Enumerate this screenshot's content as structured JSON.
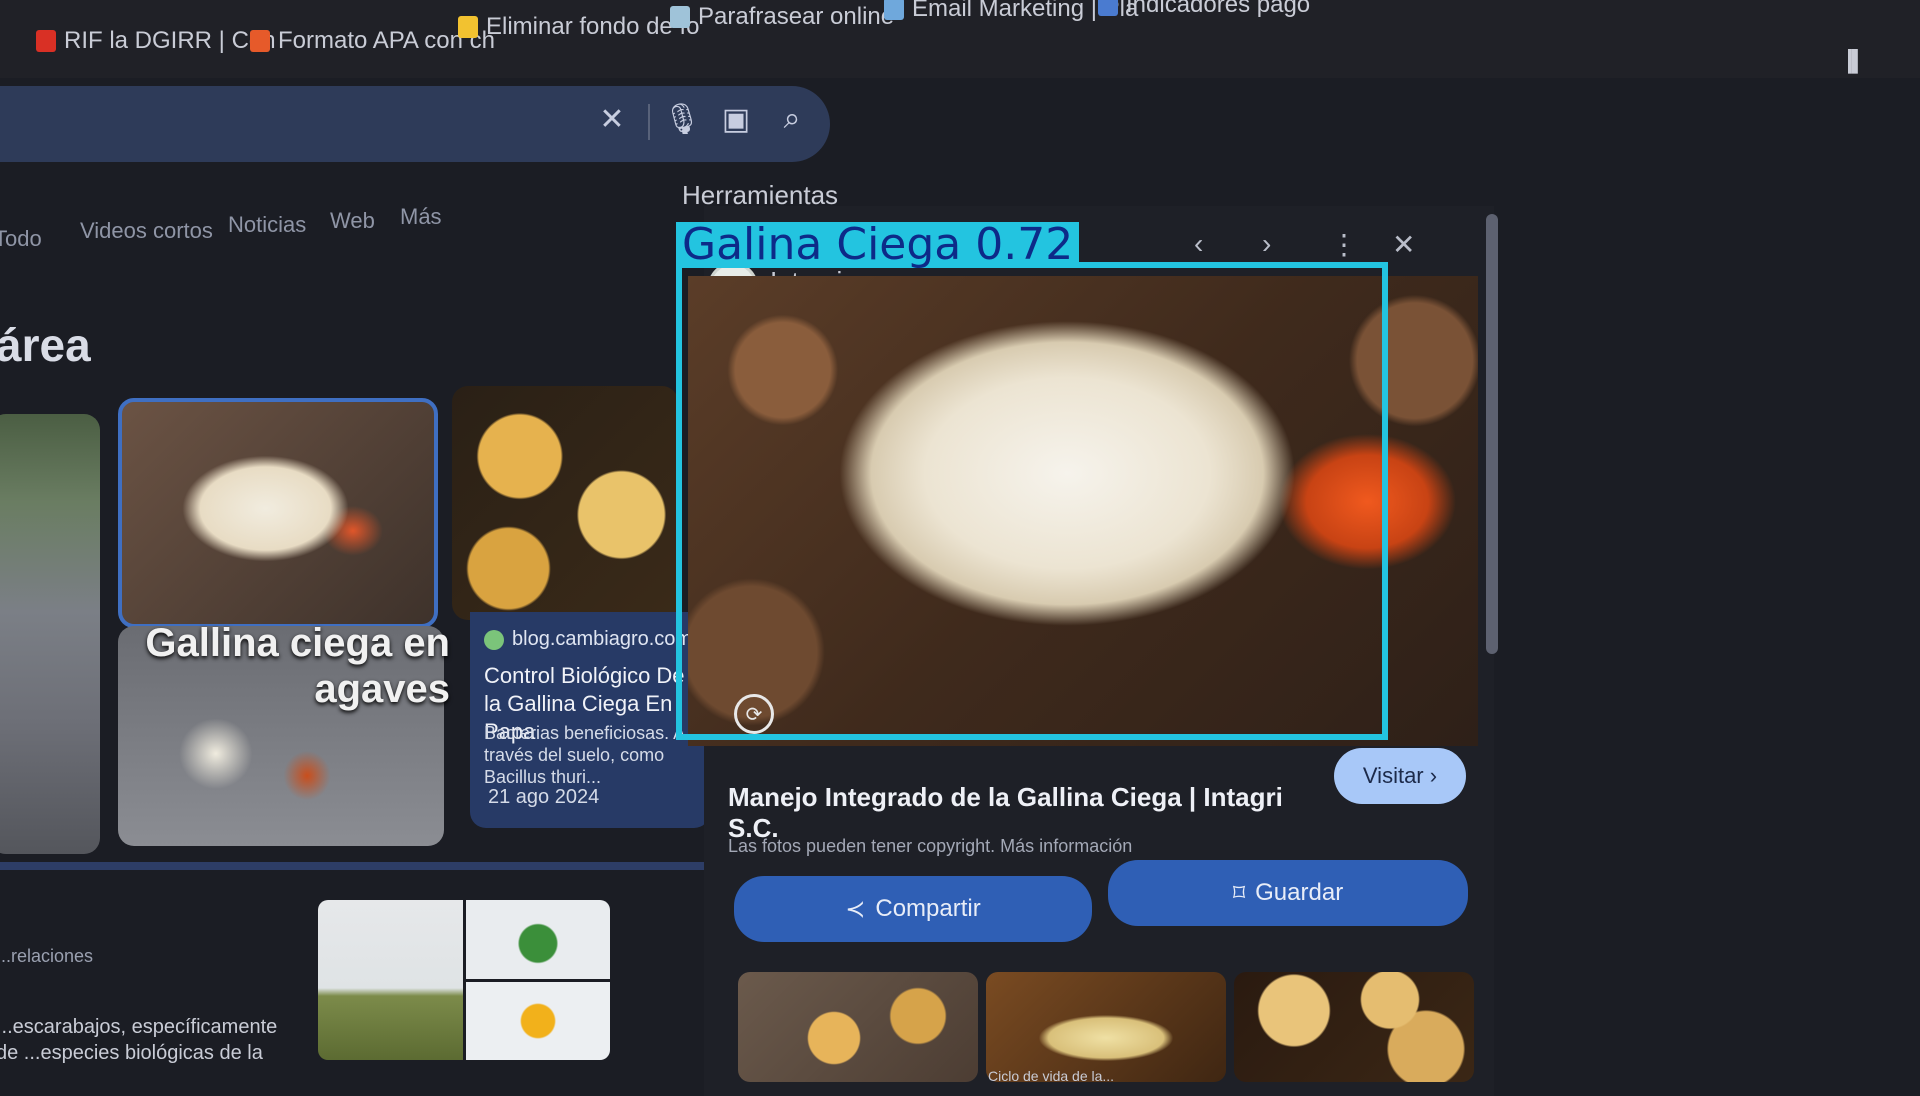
{
  "bookmarks": [
    {
      "label": "RIF la DGIRR | Cdn",
      "color": "#d93025"
    },
    {
      "label": "Formato APA con ch",
      "color": "#e65a2a"
    },
    {
      "label": "Eliminar fondo de fo",
      "color": "#f2c230"
    },
    {
      "label": "Parafrasear online",
      "color": "#9fc3d9"
    },
    {
      "label": "Email Marketing | Pla",
      "color": "#6fa8dc"
    },
    {
      "label": "Indicadores pago",
      "color": "#4a7bd0"
    }
  ],
  "search": {
    "clear_icon": "close-icon",
    "mic_icon": "mic-icon",
    "lens_icon": "camera-icon",
    "search_icon": "search-icon"
  },
  "tabs": [
    "Todo",
    "Videos cortos",
    "Noticias",
    "Web",
    "Más"
  ],
  "tools_label": "Herramientas",
  "section_title": "área",
  "results": {
    "grub_overlay_text": "Gallina ciega en agaves",
    "card": {
      "site": "blog.cambiagro.com",
      "title": "Control Biológico De la Gallina Ciega En Papa",
      "desc": "Bacterias beneficiosas. A través del suelo, como Bacillus thuri...",
      "date": "21 ago 2024"
    },
    "bottom_label": "...relaciones",
    "bottom_text": "...escarabajos, específicamente de ...especies biológicas de la"
  },
  "preview": {
    "source": "Intagri",
    "title": "Manejo Integrado de la Gallina Ciega | Intagri S.C.",
    "copyright": "Las fotos pueden tener copyright. Más información",
    "visit_label": "Visitar",
    "share_label": "Compartir",
    "save_label": "Guardar",
    "related_caption": "Ciclo de vida de la..."
  },
  "detection": {
    "label": "Galina Ciega 0.72",
    "class": "Galina Ciega",
    "confidence": 0.72,
    "color": "#23c4e0"
  }
}
